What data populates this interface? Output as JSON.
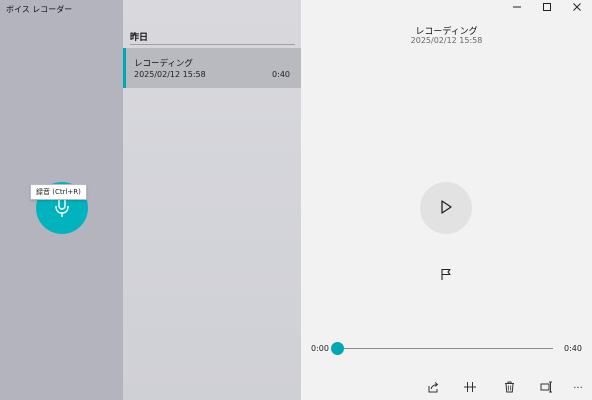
{
  "app": {
    "title": "ボイス レコーダー"
  },
  "record": {
    "tooltip": "録音 (Ctrl+R)",
    "icon": "microphone-icon",
    "color": "#00b3bd"
  },
  "list": {
    "group_header": "昨日",
    "items": [
      {
        "name": "レコーディング",
        "date": "2025/02/12 15:58",
        "duration": "0:40",
        "selected": true
      }
    ]
  },
  "detail": {
    "title": "レコーディング",
    "date": "2025/02/12 15:58",
    "time_start": "0:00",
    "time_end": "0:40",
    "progress": 0.0
  },
  "window": {
    "minimize": "—",
    "maximize": "☐",
    "close": "✕"
  },
  "toolbar": {
    "icons": [
      "share-icon",
      "trim-icon",
      "delete-icon",
      "rename-icon",
      "more-icon"
    ],
    "more": "···"
  },
  "colors": {
    "accent": "#00a8b3"
  }
}
